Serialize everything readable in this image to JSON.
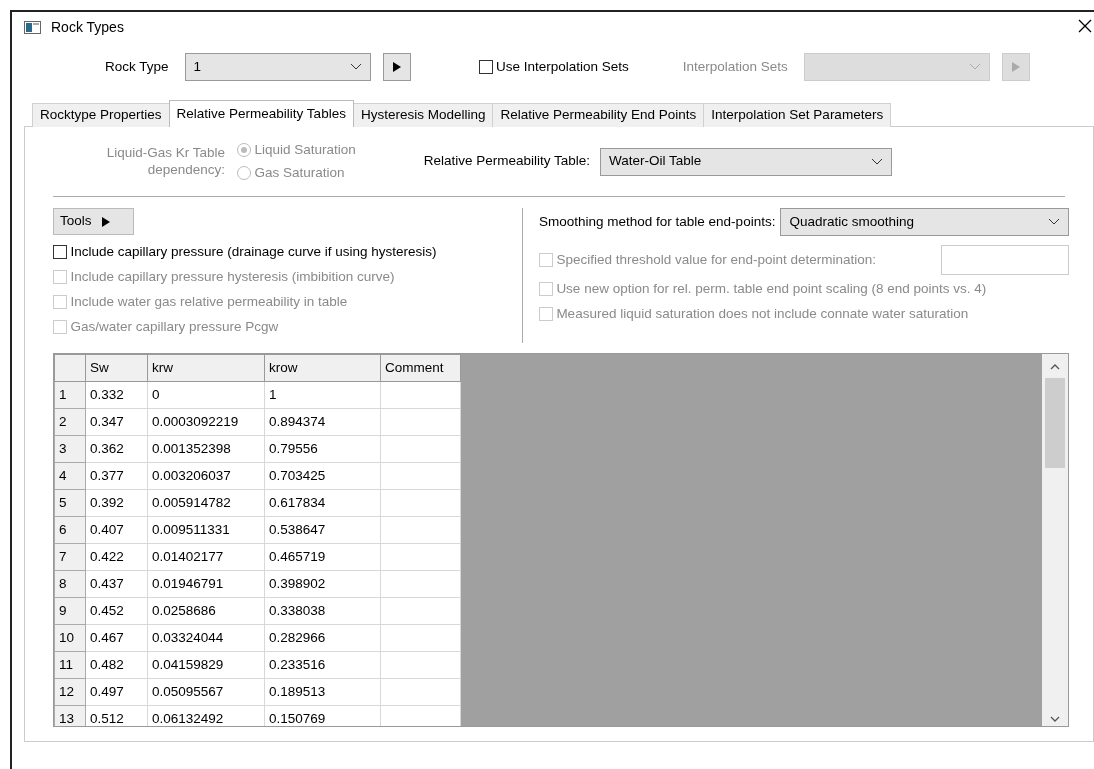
{
  "window": {
    "title": "Rock Types"
  },
  "rock_type": {
    "label": "Rock Type",
    "value": "1"
  },
  "use_interpolation_sets": {
    "label": "Use Interpolation Sets",
    "checked": false
  },
  "interpolation_sets": {
    "label": "Interpolation Sets",
    "disabled": true
  },
  "tabs": [
    {
      "label": "Rocktype Properties",
      "selected": false
    },
    {
      "label": "Relative Permeability Tables",
      "selected": true
    },
    {
      "label": "Hysteresis Modelling",
      "selected": false
    },
    {
      "label": "Relative Permeability End Points",
      "selected": false
    },
    {
      "label": "Interpolation Set Parameters",
      "selected": false
    }
  ],
  "kr_dependency": {
    "label": "Liquid-Gas Kr Table dependency:",
    "disabled": true,
    "options": [
      {
        "label": "Liquid Saturation",
        "selected": true
      },
      {
        "label": "Gas Saturation",
        "selected": false
      }
    ]
  },
  "relperm_table": {
    "label": "Relative Permeability Table:",
    "value": "Water-Oil Table"
  },
  "tools_button": {
    "label": "Tools"
  },
  "left_options": [
    {
      "label": "Include capillary pressure (drainage curve if using hysteresis)",
      "checked": false,
      "disabled": false
    },
    {
      "label": "Include capillary pressure hysteresis (imbibition curve)",
      "checked": false,
      "disabled": true
    },
    {
      "label": "Include water gas relative permeability in table",
      "checked": false,
      "disabled": true
    },
    {
      "label": "Gas/water capillary pressure Pcgw",
      "checked": false,
      "disabled": true
    }
  ],
  "smoothing": {
    "label": "Smoothing method for table end-points:",
    "value": "Quadratic smoothing"
  },
  "right_options": [
    {
      "kind": "field",
      "label": "Specified threshold value for end-point determination:",
      "checked": false,
      "disabled": true
    },
    {
      "kind": "plain",
      "label": "Use new option for rel. perm. table end point scaling (8 end points vs. 4)",
      "checked": false,
      "disabled": true
    },
    {
      "kind": "plain",
      "label": "Measured liquid saturation does not include connate water saturation",
      "checked": false,
      "disabled": true
    }
  ],
  "table": {
    "columns": [
      "",
      "Sw",
      "krw",
      "krow",
      "Comment"
    ],
    "rows": [
      [
        "1",
        "0.332",
        "0",
        "1"
      ],
      [
        "2",
        "0.347",
        "0.0003092219",
        "0.894374"
      ],
      [
        "3",
        "0.362",
        "0.001352398",
        "0.79556"
      ],
      [
        "4",
        "0.377",
        "0.003206037",
        "0.703425"
      ],
      [
        "5",
        "0.392",
        "0.005914782",
        "0.617834"
      ],
      [
        "6",
        "0.407",
        "0.009511331",
        "0.538647"
      ],
      [
        "7",
        "0.422",
        "0.01402177",
        "0.465719"
      ],
      [
        "8",
        "0.437",
        "0.01946791",
        "0.398902"
      ],
      [
        "9",
        "0.452",
        "0.0258686",
        "0.338038"
      ],
      [
        "10",
        "0.467",
        "0.03324044",
        "0.282966"
      ],
      [
        "11",
        "0.482",
        "0.04159829",
        "0.233516"
      ],
      [
        "12",
        "0.497",
        "0.05095567",
        "0.189513"
      ],
      [
        "13",
        "0.512",
        "0.06132492",
        "0.150769"
      ]
    ]
  }
}
